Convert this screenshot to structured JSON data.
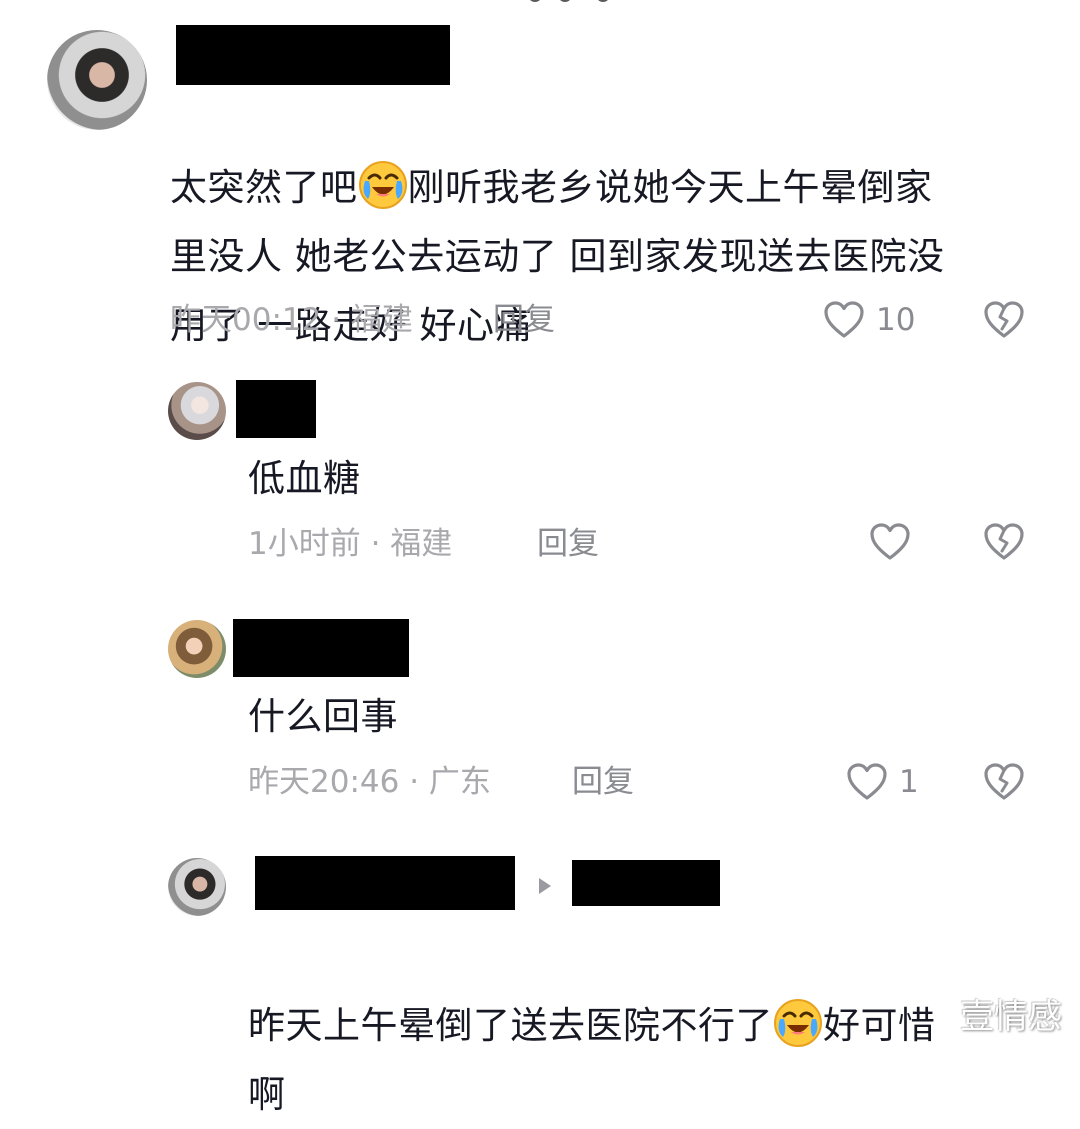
{
  "comments": [
    {
      "text_part1": "太突然了吧",
      "emoji_1": "crying-laughing-emoji",
      "text_part2": "刚听我老乡说她今天上午晕倒家\n里没人 她老公去运动了 回到家发现送去医院没\n用了 一路走好 好心痛",
      "time_location": "昨天00:12 · 福建",
      "reply_label": "回复",
      "likes": "10"
    }
  ],
  "replies": [
    {
      "text": "低血糖",
      "time_location": "1小时前 · 福建",
      "reply_label": "回复",
      "likes": ""
    },
    {
      "text": "什么回事",
      "time_location": "昨天20:46 · 广东",
      "reply_label": "回复",
      "likes": "1"
    },
    {
      "text_part1": "昨天上午晕倒了送去医院不行了",
      "emoji_1": "crying-laughing-emoji",
      "text_part2": "好可惜\n啊"
    }
  ],
  "watermark": "壹情感",
  "colors": {
    "text": "#161823",
    "meta": "#a8a8ad",
    "redaction": "#000000",
    "icon": "#8a8b91"
  },
  "icons": {
    "like": "heart-outline-icon",
    "dislike": "broken-heart-icon",
    "reply_to": "triangle-right-icon"
  }
}
